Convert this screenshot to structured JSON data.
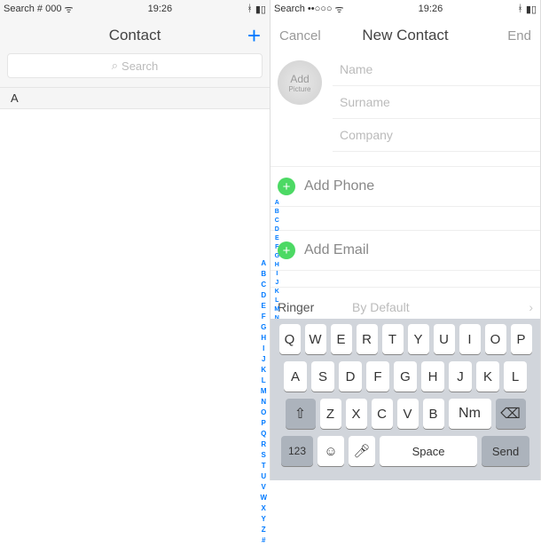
{
  "left": {
    "status": {
      "carrier": "Search # 000",
      "time": "19:26"
    },
    "nav": {
      "title": "Contact",
      "add": "+"
    },
    "search": {
      "placeholder": "Search"
    },
    "section_letter": "A",
    "az": "A\nB\nC\nD\nE\nF\nG\nH\nI\nJ\nK\nL\nM\nN\nO\nP\nQ\nR\nS\nT\nU\nV\nW\nX\nY\nZ\n#"
  },
  "right": {
    "status": {
      "carrier": "Search ••○○○",
      "time": "19:26"
    },
    "nav": {
      "cancel": "Cancel",
      "title": "New Contact",
      "end": "End"
    },
    "photo": {
      "add": "Add",
      "picture": "Picture"
    },
    "fields": {
      "name": "Name",
      "surname": "Surname",
      "company": "Company"
    },
    "add_phone": "Add Phone",
    "add_email": "Add Email",
    "ringer": {
      "label": "Ringer",
      "value": "By Default"
    },
    "az": "A\nB\nC\nD\nE\nF\nG\nH\nI\nJ\nK\nL\nM\nN\n\nP\nQ\nR\nS\nT\nU\nV\nW\nX\nY\nZ\n#",
    "keyboard": {
      "row1": [
        "Q",
        "W",
        "E",
        "R",
        "T",
        "Y",
        "U",
        "I",
        "O",
        "P"
      ],
      "row2": [
        "A",
        "S",
        "D",
        "F",
        "G",
        "H",
        "J",
        "K",
        "L"
      ],
      "row3": [
        "Z",
        "X",
        "C",
        "V",
        "B"
      ],
      "nm": "Nm",
      "k123": "123",
      "space": "Space",
      "send": "Send"
    }
  }
}
